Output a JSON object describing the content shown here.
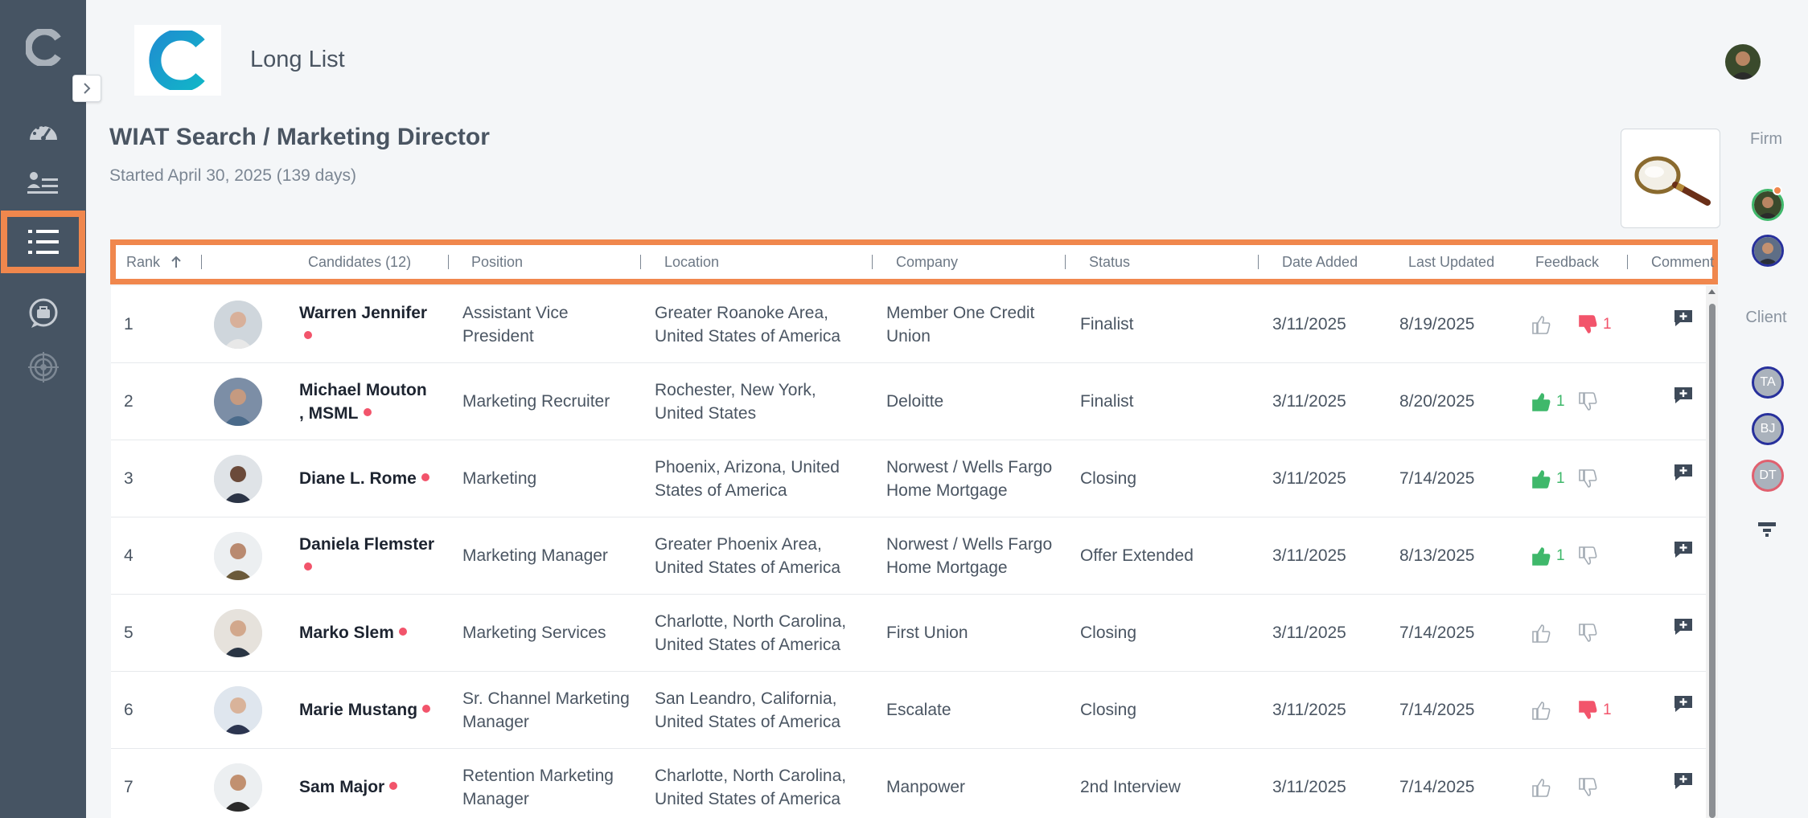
{
  "header": {
    "title": "Long List",
    "search_title": "WIAT Search / Marketing Director",
    "started": "Started April 30, 2025 (139 days)"
  },
  "sidebar": {
    "items": [
      {
        "icon": "dashboard-gauge-icon"
      },
      {
        "icon": "people-list-icon"
      },
      {
        "icon": "long-list-icon",
        "active": true
      },
      {
        "icon": "briefcase-chat-icon"
      },
      {
        "icon": "target-icon"
      }
    ]
  },
  "right_panel": {
    "firm_label": "Firm",
    "client_label": "Client",
    "client_members": [
      {
        "initials": "TA",
        "border": "#27309c"
      },
      {
        "initials": "BJ",
        "border": "#27309c"
      },
      {
        "initials": "DT",
        "border": "#e0606f"
      }
    ]
  },
  "columns": {
    "rank": "Rank",
    "candidates": "Candidates (12)",
    "position": "Position",
    "location": "Location",
    "company": "Company",
    "status": "Status",
    "date_added": "Date Added",
    "last_updated": "Last Updated",
    "feedback": "Feedback",
    "comment": "Comment"
  },
  "rows": [
    {
      "rank": "1",
      "name": "Warren Jennifer",
      "position": "Assistant Vice President",
      "location": "Greater Roanoke Area, United States of America",
      "company": "Member One Credit Union",
      "status": "Finalist",
      "date_added": "3/11/2025",
      "last_updated": "8/19/2025",
      "up": "",
      "down": "1"
    },
    {
      "rank": "2",
      "name": "Michael Mouton , MSML",
      "position": "Marketing Recruiter",
      "location": "Rochester, New York, United States",
      "company": "Deloitte",
      "status": "Finalist",
      "date_added": "3/11/2025",
      "last_updated": "8/20/2025",
      "up": "1",
      "down": ""
    },
    {
      "rank": "3",
      "name": "Diane L. Rome",
      "position": "Marketing",
      "location": "Phoenix, Arizona, United States of America",
      "company": "Norwest / Wells Fargo Home Mortgage",
      "status": "Closing",
      "date_added": "3/11/2025",
      "last_updated": "7/14/2025",
      "up": "1",
      "down": ""
    },
    {
      "rank": "4",
      "name": "Daniela Flemster",
      "position": "Marketing Manager",
      "location": "Greater Phoenix Area, United States of America",
      "company": "Norwest / Wells Fargo Home Mortgage",
      "status": "Offer Extended",
      "date_added": "3/11/2025",
      "last_updated": "8/13/2025",
      "up": "1",
      "down": ""
    },
    {
      "rank": "5",
      "name": "Marko Slem",
      "position": "Marketing Services",
      "location": "Charlotte, North Carolina, United States of America",
      "company": "First Union",
      "status": "Closing",
      "date_added": "3/11/2025",
      "last_updated": "7/14/2025",
      "up": "",
      "down": ""
    },
    {
      "rank": "6",
      "name": "Marie Mustang",
      "position": "Sr. Channel Marketing Manager",
      "location": "San Leandro, California, United States of America",
      "company": "Escalate",
      "status": "Closing",
      "date_added": "3/11/2025",
      "last_updated": "7/14/2025",
      "up": "",
      "down": "1"
    },
    {
      "rank": "7",
      "name": "Sam Major",
      "position": "Retention Marketing Manager",
      "location": "Charlotte, North Carolina, United States of America",
      "company": "Manpower",
      "status": "2nd Interview",
      "date_added": "3/11/2025",
      "last_updated": "7/14/2025",
      "up": "",
      "down": ""
    }
  ],
  "colors": {
    "sidebar": "#465463",
    "accent": "#f0874d",
    "thumb_up": "#3fb86b",
    "thumb_down": "#f2546b",
    "status_dot": "#f2546b"
  }
}
